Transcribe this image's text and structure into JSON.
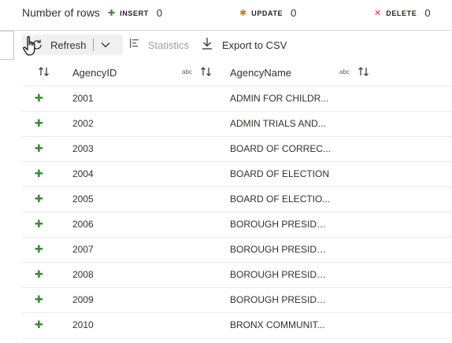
{
  "summary": {
    "title": "Number of rows",
    "insert": {
      "icon": "plus-icon",
      "label": "INSERT",
      "count": "0",
      "color": "#3a8a32"
    },
    "update": {
      "icon": "asterisk-icon",
      "label": "UPDATE",
      "count": "0",
      "color": "#d07a12"
    },
    "delete": {
      "icon": "x-icon",
      "label": "DELETE",
      "count": "0",
      "color": "#d13438"
    }
  },
  "toolbar": {
    "refresh_label": "Refresh",
    "statistics_label": "Statistics",
    "export_label": "Export to CSV"
  },
  "grid": {
    "columns": [
      {
        "title": "AgencyID",
        "type_label": "abc"
      },
      {
        "title": "AgencyName",
        "type_label": "abc"
      }
    ],
    "rows": [
      {
        "status": "insert",
        "id": "2001",
        "name": "ADMIN FOR CHILDR..."
      },
      {
        "status": "insert",
        "id": "2002",
        "name": "ADMIN TRIALS AND..."
      },
      {
        "status": "insert",
        "id": "2003",
        "name": "BOARD OF CORREC..."
      },
      {
        "status": "insert",
        "id": "2004",
        "name": "BOARD OF ELECTION"
      },
      {
        "status": "insert",
        "id": "2005",
        "name": "BOARD OF ELECTIO..."
      },
      {
        "status": "insert",
        "id": "2006",
        "name": "BOROUGH PRESIDE..."
      },
      {
        "status": "insert",
        "id": "2007",
        "name": "BOROUGH PRESIDE..."
      },
      {
        "status": "insert",
        "id": "2008",
        "name": "BOROUGH PRESIDE..."
      },
      {
        "status": "insert",
        "id": "2009",
        "name": "BOROUGH PRESIDE..."
      },
      {
        "status": "insert",
        "id": "2010",
        "name": "BRONX COMMUNIT..."
      }
    ]
  }
}
